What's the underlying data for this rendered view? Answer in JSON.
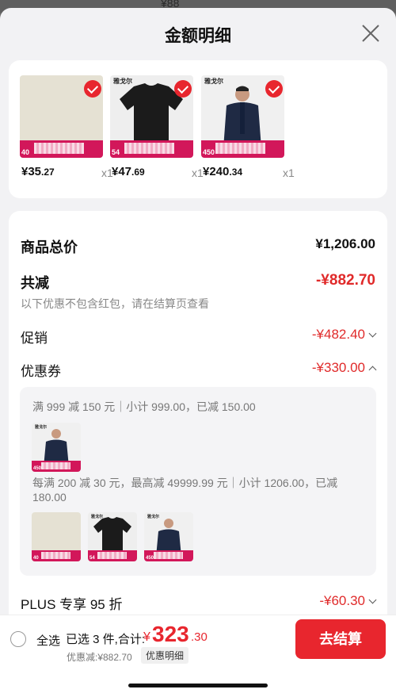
{
  "backdrop_price": "¥88",
  "sheet": {
    "title": "金额明细"
  },
  "products": [
    {
      "price_int": "¥35",
      "price_dec": ".27",
      "qty": "x1",
      "promo_num": "40",
      "tone": "#e5e1d3",
      "kind": "fabric"
    },
    {
      "price_int": "¥47",
      "price_dec": ".69",
      "qty": "x1",
      "promo_num": "54",
      "tone": "#eeeeee",
      "kind": "tshirt"
    },
    {
      "price_int": "¥240",
      "price_dec": ".34",
      "qty": "x1",
      "promo_num": "450",
      "tone": "#f0f0f0",
      "kind": "jacket"
    }
  ],
  "brand_mark": "雅戈尔",
  "summary": {
    "total_label": "商品总价",
    "total_value": "¥1,206.00",
    "reduce_label": "共减",
    "reduce_value": "-¥882.70",
    "reduce_note": "以下优惠不包含红包，请在结算页查看",
    "promo_label": "促销",
    "promo_value": "-¥482.40",
    "coupon_label": "优惠券",
    "coupon_value": "-¥330.00",
    "plus_label": "PLUS 专享 95 折",
    "plus_value": "-¥60.30"
  },
  "coupons": {
    "rule1": "满 999 减 150 元｜小计 999.00，已减 150.00",
    "rule2": "每满 200 减 30 元，最高减 49999.99 元｜小计 1206.00，已减 180.00"
  },
  "bottom": {
    "select_all": "全选",
    "selected_sum": "已选 3 件,合计:",
    "currency": "¥",
    "total_int": "323",
    "total_dec": ".30",
    "discount": "优惠减:¥882.70",
    "detail_link": "优惠明细",
    "checkout": "去结算"
  },
  "colors": {
    "accent": "#e8262e",
    "promo": "#d2175a"
  }
}
